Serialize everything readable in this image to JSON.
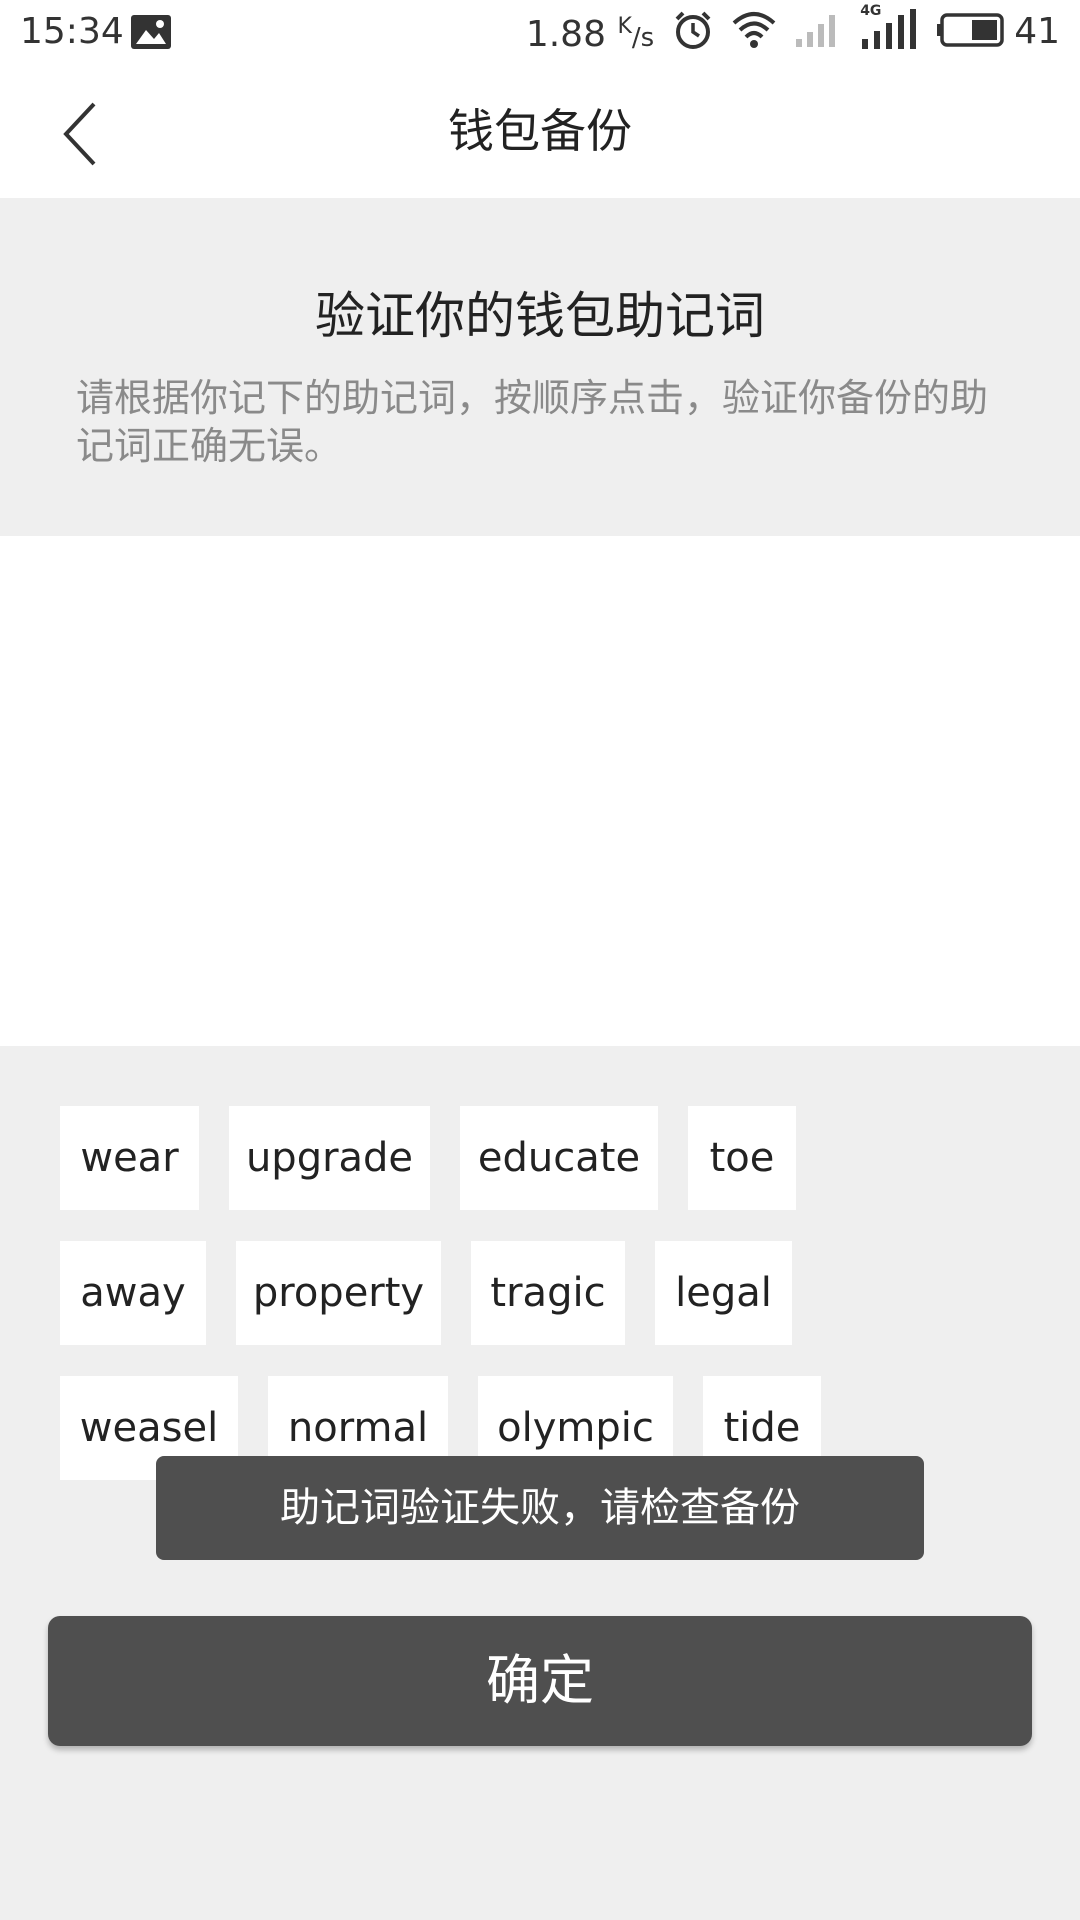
{
  "status_bar": {
    "time": "15:34",
    "speed": "1.88",
    "speed_unit_top": "K",
    "speed_unit_bottom": "/s",
    "network": "4G",
    "battery": "41"
  },
  "nav": {
    "title": "钱包备份",
    "back_icon": "chevron-left-icon"
  },
  "instruction": {
    "title": "验证你的钱包助记词",
    "description": "请根据你记下的助记词，按顺序点击，验证你备份的助记词正确无误。"
  },
  "words": [
    "wear",
    "upgrade",
    "educate",
    "toe",
    "away",
    "property",
    "tragic",
    "legal",
    "weasel",
    "normal",
    "olympic",
    "tide"
  ],
  "toast": {
    "message": "助记词验证失败，请检查备份"
  },
  "confirm": {
    "label": "确定"
  },
  "colors": {
    "button_bg": "#4f4f4f",
    "page_bg": "#efefef",
    "card_bg": "#ffffff",
    "hint_text": "#8a8a8a"
  }
}
